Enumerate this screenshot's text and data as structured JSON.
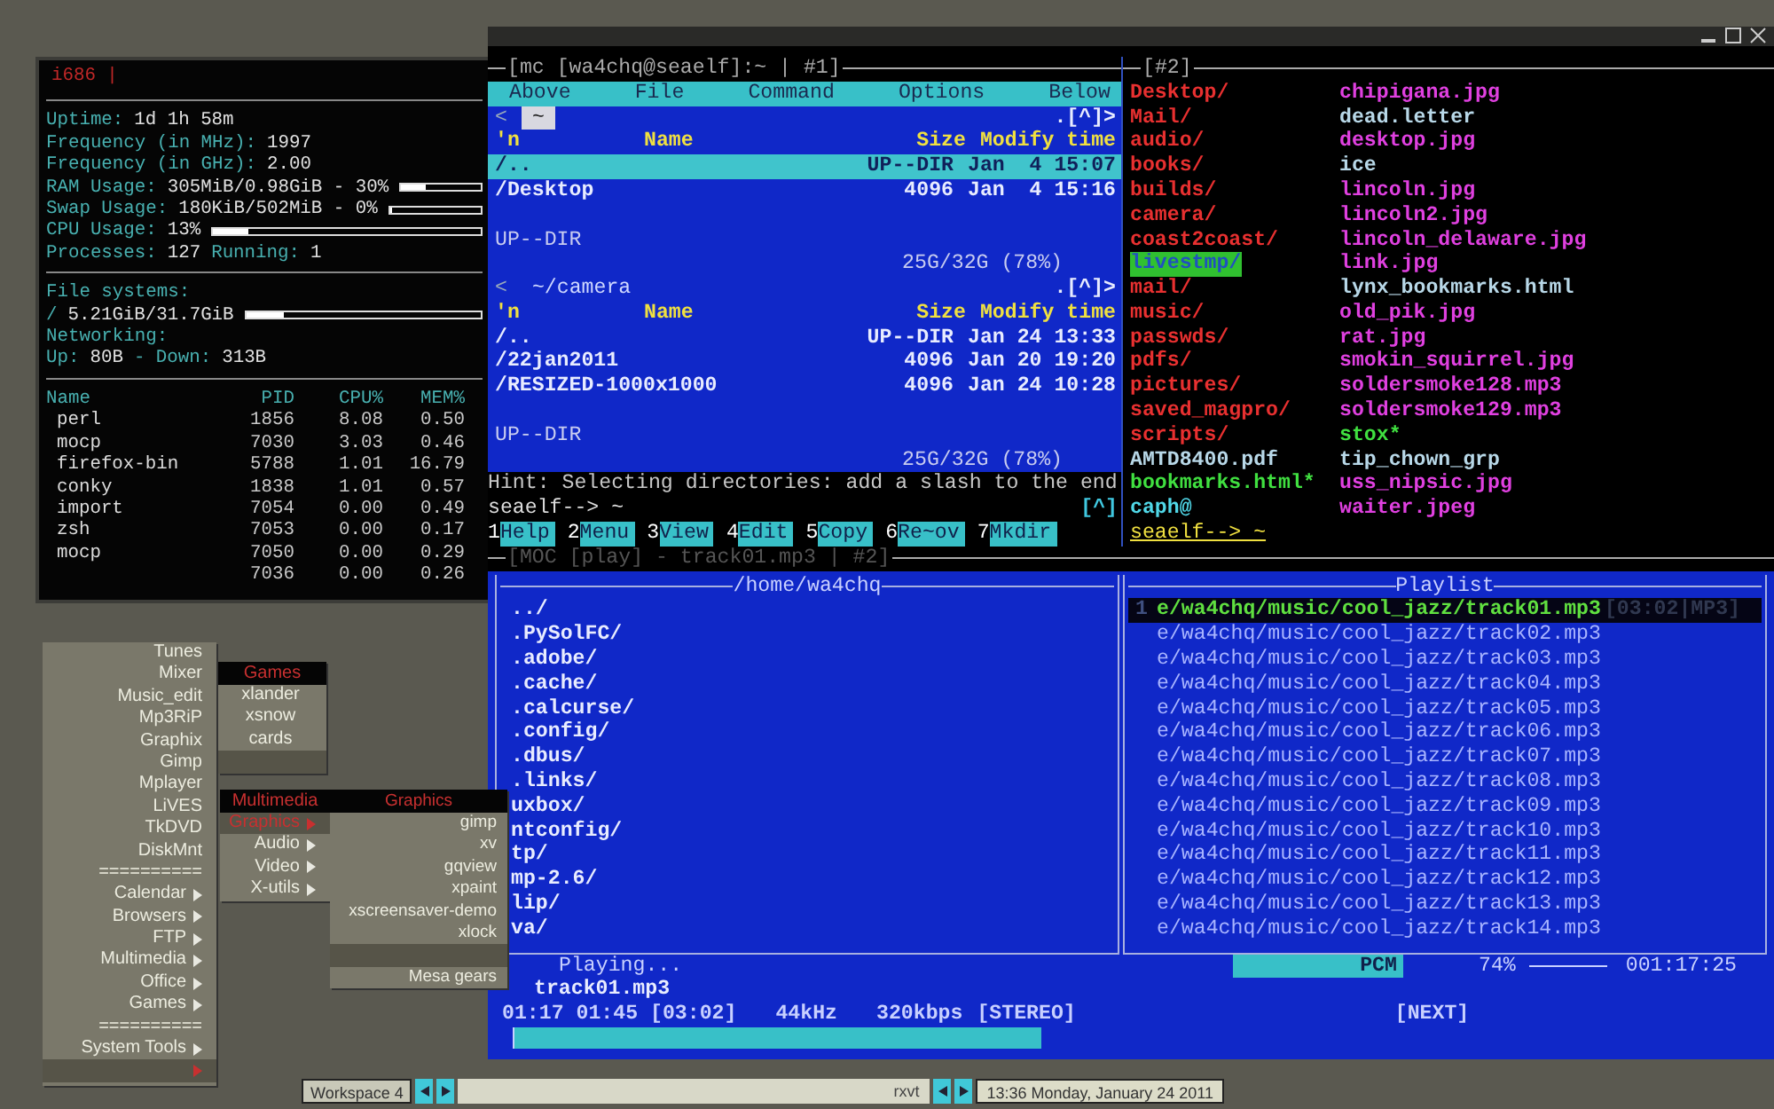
{
  "conky": {
    "title": "i686 |",
    "sections": [
      [
        {
          "parts": [
            {
              "text": "Uptime:",
              "kind": "label"
            },
            {
              "text": "1d 1h 58m",
              "kind": "value"
            }
          ]
        },
        {
          "parts": [
            {
              "text": "Frequency (in MHz):",
              "kind": "label"
            },
            {
              "text": "1997",
              "kind": "value"
            }
          ]
        },
        {
          "parts": [
            {
              "text": "Frequency (in GHz):",
              "kind": "label"
            },
            {
              "text": "2.00",
              "kind": "value"
            }
          ]
        },
        {
          "parts": [
            {
              "text": "RAM Usage:",
              "kind": "label"
            },
            {
              "text": "305MiB/0.98GiB - 30%",
              "kind": "value"
            }
          ],
          "level": 0.3
        },
        {
          "parts": [
            {
              "text": "Swap Usage:",
              "kind": "label"
            },
            {
              "text": "180KiB/502MiB - 0%",
              "kind": "value"
            }
          ],
          "level": 0
        },
        {
          "parts": [
            {
              "text": "CPU Usage:",
              "kind": "label"
            },
            {
              "text": "13%",
              "kind": "value"
            }
          ],
          "level": 0.13
        },
        {
          "parts": [
            {
              "text": "Processes:",
              "kind": "label"
            },
            {
              "text": "127",
              "kind": "value"
            },
            {
              "text": "Running:",
              "kind": "label"
            },
            {
              "text": "1",
              "kind": "value"
            }
          ]
        }
      ],
      [
        {
          "parts": [
            {
              "text": "File systems:",
              "kind": "label"
            }
          ]
        },
        {
          "parts": [
            {
              "text": "/",
              "kind": "label"
            },
            {
              "text": "5.21GiB/31.7GiB",
              "kind": "value"
            }
          ],
          "level": 0.16
        },
        {
          "parts": [
            {
              "text": "Networking:",
              "kind": "label"
            }
          ]
        },
        {
          "parts": [
            {
              "text": "Up:",
              "kind": "label"
            },
            {
              "text": "80B",
              "kind": "value"
            },
            {
              "text": "- Down:",
              "kind": "label"
            },
            {
              "text": "313B",
              "kind": "value"
            }
          ]
        }
      ]
    ],
    "processes": {
      "columns": [
        "Name",
        "PID",
        "CPU%",
        "MEM%"
      ],
      "rows": [
        [
          "perl",
          "1856",
          "8.08",
          "0.50"
        ],
        [
          "mocp",
          "7030",
          "3.03",
          "0.46"
        ],
        [
          "firefox-bin",
          "5788",
          "1.01",
          "16.79"
        ],
        [
          "conky",
          "1838",
          "1.01",
          "0.57"
        ],
        [
          "import",
          "7054",
          "0.00",
          "0.49"
        ],
        [
          "zsh",
          "7053",
          "0.00",
          "0.17"
        ],
        [
          "mocp",
          "7050",
          "0.00",
          "0.29"
        ],
        [
          "",
          "7036",
          "0.00",
          "0.26"
        ]
      ]
    }
  },
  "mc": {
    "title": "[mc [wa4chq@seaelf]:~ | #1]",
    "menu": [
      "Above",
      "File",
      "Command",
      "Options",
      "Below"
    ],
    "panels": [
      {
        "bracket": "<",
        "path": "~",
        "active": true,
        "corner": ".[^]>",
        "columns": [
          "'n",
          "Name",
          "Size",
          "Modify time"
        ],
        "rows": [
          {
            "name": "/..",
            "size": "UP--DIR",
            "modified": "Jan  4 15:07",
            "selected": true
          },
          {
            "name": "/Desktop",
            "size": "4096",
            "modified": "Jan  4 15:16",
            "selected": false
          }
        ],
        "status": "UP--DIR",
        "disk": "25G/32G (78%)"
      },
      {
        "bracket": "<",
        "path": "~/camera",
        "active": false,
        "corner": ".[^]>",
        "columns": [
          "'n",
          "Name",
          "Size",
          "Modify time"
        ],
        "rows": [
          {
            "name": "/..",
            "size": "UP--DIR",
            "modified": "Jan 24 13:33",
            "selected": false
          },
          {
            "name": "/22jan2011",
            "size": "4096",
            "modified": "Jan 20 19:20",
            "selected": false
          },
          {
            "name": "/RESIZED-1000x1000",
            "size": "4096",
            "modified": "Jan 24 10:28",
            "selected": false
          }
        ],
        "status": "UP--DIR",
        "disk": "25G/32G (78%)"
      }
    ],
    "hint": "Hint: Selecting directories: add a slash to the end",
    "prompt": "seaelf--> ~",
    "prompt_marker": "[^]",
    "fkeys": [
      {
        "num": "1",
        "label": "Help"
      },
      {
        "num": "2",
        "label": "Menu"
      },
      {
        "num": "3",
        "label": "View"
      },
      {
        "num": "4",
        "label": "Edit"
      },
      {
        "num": "5",
        "label": "Copy"
      },
      {
        "num": "6",
        "label": "Re~ov"
      },
      {
        "num": "7",
        "label": "Mkdir"
      }
    ]
  },
  "shell": {
    "title": "[#2]",
    "columns": [
      [
        {
          "name": "Desktop/",
          "color": "#e83030",
          "marked": false
        },
        {
          "name": "Mail/",
          "color": "#e83030",
          "marked": false
        },
        {
          "name": "audio/",
          "color": "#e83030",
          "marked": false
        },
        {
          "name": "books/",
          "color": "#e83030",
          "marked": false
        },
        {
          "name": "builds/",
          "color": "#e83030",
          "marked": false
        },
        {
          "name": "camera/",
          "color": "#e83030",
          "marked": false
        },
        {
          "name": "coast2coast/",
          "color": "#e83030",
          "marked": false
        },
        {
          "name": "livestmp/",
          "color": "#30c030",
          "marked": true
        },
        {
          "name": "mail/",
          "color": "#e83030",
          "marked": false
        },
        {
          "name": "music/",
          "color": "#e83030",
          "marked": false
        },
        {
          "name": "passwds/",
          "color": "#e83030",
          "marked": false
        },
        {
          "name": "pdfs/",
          "color": "#e83030",
          "marked": false
        },
        {
          "name": "pictures/",
          "color": "#e83030",
          "marked": false
        },
        {
          "name": "saved_magpro/",
          "color": "#e83030",
          "marked": false
        },
        {
          "name": "scripts/",
          "color": "#e83030",
          "marked": false
        },
        {
          "name": "AMTD8400.pdf",
          "color": "#b8d8e8",
          "marked": false
        },
        {
          "name": "bookmarks.html*",
          "color": "#40e040",
          "marked": false
        },
        {
          "name": "caph@",
          "color": "#50d8e8",
          "marked": false
        }
      ],
      [
        {
          "name": "chipigana.jpg",
          "color": "#e040e0",
          "marked": false
        },
        {
          "name": "dead.letter",
          "color": "#b8d8e8",
          "marked": false
        },
        {
          "name": "desktop.jpg",
          "color": "#e040e0",
          "marked": false
        },
        {
          "name": "ice",
          "color": "#b8d8e8",
          "marked": false
        },
        {
          "name": "lincoln.jpg",
          "color": "#e040e0",
          "marked": false
        },
        {
          "name": "lincoln2.jpg",
          "color": "#e040e0",
          "marked": false
        },
        {
          "name": "lincoln_delaware.jpg",
          "color": "#e040e0",
          "marked": false
        },
        {
          "name": "link.jpg",
          "color": "#e040e0",
          "marked": false
        },
        {
          "name": "lynx_bookmarks.html",
          "color": "#b8d8e8",
          "marked": false
        },
        {
          "name": "old_pik.jpg",
          "color": "#e040e0",
          "marked": false
        },
        {
          "name": "rat.jpg",
          "color": "#e040e0",
          "marked": false
        },
        {
          "name": "smokin_squirrel.jpg",
          "color": "#e040e0",
          "marked": false
        },
        {
          "name": "soldersmoke128.mp3",
          "color": "#e040e0",
          "marked": false
        },
        {
          "name": "soldersmoke129.mp3",
          "color": "#e040e0",
          "marked": false
        },
        {
          "name": "stox*",
          "color": "#40e040",
          "marked": false
        },
        {
          "name": "tip_chown_grp",
          "color": "#b8d8e8",
          "marked": false
        },
        {
          "name": "uss_nipsic.jpg",
          "color": "#e040e0",
          "marked": false
        },
        {
          "name": "waiter.jpeg",
          "color": "#e040e0",
          "marked": false
        }
      ]
    ],
    "prompt": "seaelf--> ~"
  },
  "moc": {
    "title": "[MOC [play] - track01.mp3 | #2]",
    "browser": {
      "title": "/home/wa4chq",
      "items": [
        "../",
        ".PySolFC/",
        ".adobe/",
        ".cache/",
        ".calcurse/",
        ".config/",
        ".dbus/",
        ".links/",
        "uxbox/",
        "ntconfig/",
        "tp/",
        "mp-2.6/",
        "lip/",
        "va/"
      ]
    },
    "playlist": {
      "title": "Playlist",
      "items": [
        {
          "number": "1",
          "path": "e/wa4chq/music/cool_jazz/track01.mp3",
          "info": "[03:02|MP3]",
          "selected": true
        },
        {
          "path": "e/wa4chq/music/cool_jazz/track02.mp3",
          "selected": false
        },
        {
          "path": "e/wa4chq/music/cool_jazz/track03.mp3",
          "selected": false
        },
        {
          "path": "e/wa4chq/music/cool_jazz/track04.mp3",
          "selected": false
        },
        {
          "path": "e/wa4chq/music/cool_jazz/track05.mp3",
          "selected": false
        },
        {
          "path": "e/wa4chq/music/cool_jazz/track06.mp3",
          "selected": false
        },
        {
          "path": "e/wa4chq/music/cool_jazz/track07.mp3",
          "selected": false
        },
        {
          "path": "e/wa4chq/music/cool_jazz/track08.mp3",
          "selected": false
        },
        {
          "path": "e/wa4chq/music/cool_jazz/track09.mp3",
          "selected": false
        },
        {
          "path": "e/wa4chq/music/cool_jazz/track10.mp3",
          "selected": false
        },
        {
          "path": "e/wa4chq/music/cool_jazz/track11.mp3",
          "selected": false
        },
        {
          "path": "e/wa4chq/music/cool_jazz/track12.mp3",
          "selected": false
        },
        {
          "path": "e/wa4chq/music/cool_jazz/track13.mp3",
          "selected": false
        },
        {
          "path": "e/wa4chq/music/cool_jazz/track14.mp3",
          "selected": false
        }
      ]
    },
    "status": "Playing...",
    "file": "track01.mp3",
    "time": "01:17 01:45 [03:02]",
    "rate": "44kHz",
    "bitrate": "320kbps",
    "channels": "[STEREO]",
    "next": "[NEXT]",
    "progress": {
      "level": 0.42
    },
    "volume": {
      "label": "PCM",
      "reading": "74%",
      "level": 0.74
    },
    "total": "001:17:25"
  },
  "menus": [
    {
      "kind": "root",
      "items": [
        {
          "label": "Tunes",
          "submenu": false,
          "selected": false
        },
        {
          "label": "Mixer",
          "submenu": false,
          "selected": false
        },
        {
          "label": "Music_edit",
          "submenu": false,
          "selected": false
        },
        {
          "label": "Mp3RiP",
          "submenu": false,
          "selected": false
        },
        {
          "label": "Graphix",
          "submenu": false,
          "selected": false
        },
        {
          "label": "Gimp",
          "submenu": false,
          "selected": false
        },
        {
          "label": "Mplayer",
          "submenu": false,
          "selected": false
        },
        {
          "label": "LiVES",
          "submenu": false,
          "selected": false
        },
        {
          "label": "TkDVD",
          "submenu": false,
          "selected": false
        },
        {
          "label": "DiskMnt",
          "submenu": false,
          "selected": false
        },
        {
          "label": "==========",
          "submenu": false,
          "selected": false
        },
        {
          "label": "Calendar",
          "submenu": true,
          "selected": false
        },
        {
          "label": "Browsers",
          "submenu": true,
          "selected": false
        },
        {
          "label": "FTP",
          "submenu": true,
          "selected": false
        },
        {
          "label": "Multimedia",
          "submenu": true,
          "selected": false
        },
        {
          "label": "Office",
          "submenu": true,
          "selected": false
        },
        {
          "label": "Games",
          "submenu": true,
          "selected": false
        },
        {
          "label": "==========",
          "submenu": false,
          "selected": false
        },
        {
          "label": "System Tools",
          "submenu": true,
          "selected": false
        },
        {
          "submenu": true,
          "selected": true
        }
      ]
    },
    {
      "kind": "games",
      "title": "Games",
      "items": [
        {
          "label": "xlander",
          "submenu": false,
          "selected": false
        },
        {
          "label": "xsnow",
          "submenu": false,
          "selected": false
        },
        {
          "label": "cards",
          "submenu": false,
          "selected": false
        },
        {
          "submenu": false,
          "selected": true
        }
      ]
    },
    {
      "kind": "multimedia",
      "title": "Multimedia",
      "items": [
        {
          "label": "Graphics",
          "submenu": true,
          "selected": true
        },
        {
          "label": "Audio",
          "submenu": true,
          "selected": false
        },
        {
          "label": "Video",
          "submenu": true,
          "selected": false
        },
        {
          "label": "X-utils",
          "submenu": true,
          "selected": false
        }
      ]
    },
    {
      "kind": "graphics",
      "title": "Graphics",
      "items": [
        {
          "label": "gimp",
          "submenu": false,
          "selected": false
        },
        {
          "label": "xv",
          "submenu": false,
          "selected": false
        },
        {
          "label": "gqview",
          "submenu": false,
          "selected": false
        },
        {
          "label": "xpaint",
          "submenu": false,
          "selected": false
        },
        {
          "label": "xscreensaver-demo",
          "submenu": false,
          "selected": false
        },
        {
          "label": "xlock",
          "submenu": false,
          "selected": false
        },
        {
          "submenu": false,
          "selected": true
        },
        {
          "label": "Mesa gears",
          "submenu": false,
          "selected": false
        }
      ]
    }
  ],
  "taskbar": {
    "workspace": "Workspace 4",
    "task": "rxvt",
    "clock": "13:36 Monday, January 24 2011"
  }
}
